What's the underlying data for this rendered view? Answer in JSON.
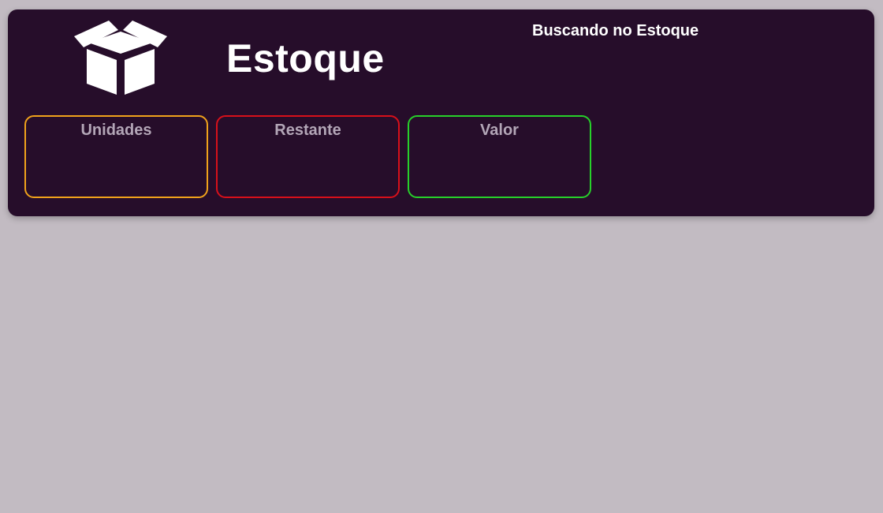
{
  "header": {
    "title": "Estoque",
    "logo_icon": "open-box-icon",
    "search_status": "Buscando no Estoque"
  },
  "cards": [
    {
      "label": "Unidades",
      "value": "",
      "border_color": "#f0a21b"
    },
    {
      "label": "Restante",
      "value": "",
      "border_color": "#d8101a"
    },
    {
      "label": "Valor",
      "value": "",
      "border_color": "#27d02a"
    }
  ],
  "colors": {
    "page_background": "#c2bbc2",
    "panel_background": "#260d2a",
    "title_text": "#ffffff",
    "card_label_text": "#b3a6b7"
  }
}
